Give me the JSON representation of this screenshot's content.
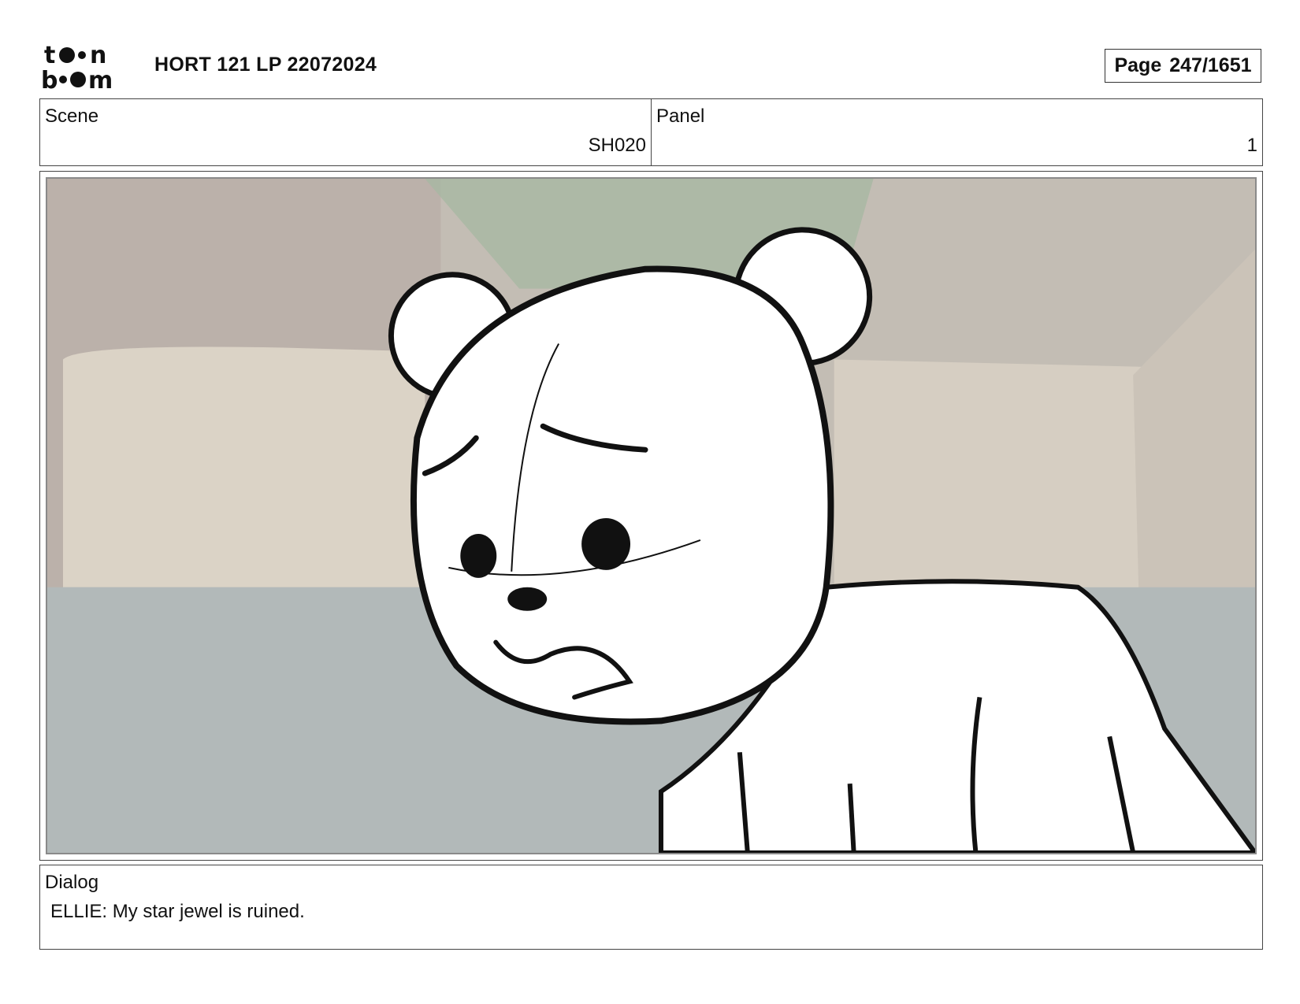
{
  "header": {
    "logo": {
      "line1": "toon",
      "line2": "boom"
    },
    "title": "HORT 121 LP 22072024",
    "page_label": "Page",
    "page_value": "247/1651"
  },
  "info": {
    "scene_label": "Scene",
    "scene_value": "SH020",
    "panel_label": "Panel",
    "panel_value": "1"
  },
  "panel": {
    "image_description_icon": "sketch-image"
  },
  "dialog": {
    "label": "Dialog",
    "text": "ELLIE: My star jewel is ruined."
  },
  "colors": {
    "frame_border": "#444444",
    "background_wall": "#c9c2b8",
    "background_floor": "#b0b6b6"
  }
}
